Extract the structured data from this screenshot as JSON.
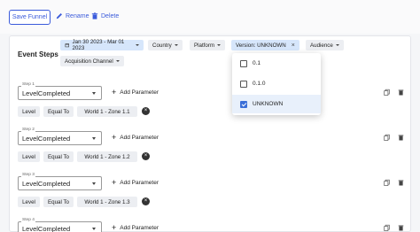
{
  "toolbar": {
    "save_label": "Save Funnel",
    "rename_label": "Rename",
    "delete_label": "Delete"
  },
  "panel": {
    "title": "Event Steps"
  },
  "filters": {
    "date": "Jan 30 2023 - Mar 01 2023",
    "country": "Country",
    "platform": "Platform",
    "version": "Version: UNKNOWN",
    "audience": "Audience",
    "acquisition": "Acquisition Channel"
  },
  "version_dropdown": {
    "options": [
      {
        "label": "0.1",
        "checked": false
      },
      {
        "label": "0.1.0",
        "checked": false
      },
      {
        "label": "UNKNOWN",
        "checked": true
      }
    ]
  },
  "steps": [
    {
      "label": "Step 1",
      "event": "LevelCompleted",
      "add_param": "Add Parameter",
      "param": "Level",
      "operator": "Equal To",
      "value": "World 1 - Zone 1.1"
    },
    {
      "label": "Step 2",
      "event": "LevelCompleted",
      "add_param": "Add Parameter",
      "param": "Level",
      "operator": "Equal To",
      "value": "World 1 - Zone 1.2"
    },
    {
      "label": "Step 3",
      "event": "LevelCompleted",
      "add_param": "Add Parameter",
      "param": "Level",
      "operator": "Equal To",
      "value": "World 1 - Zone 1.3"
    },
    {
      "label": "Step 4",
      "event": "LevelCompleted",
      "add_param": "Add Parameter"
    }
  ],
  "colors": {
    "accent": "#3b5bdb",
    "active_chip": "#d6e6fb",
    "checkbox": "#3b6fd8"
  }
}
